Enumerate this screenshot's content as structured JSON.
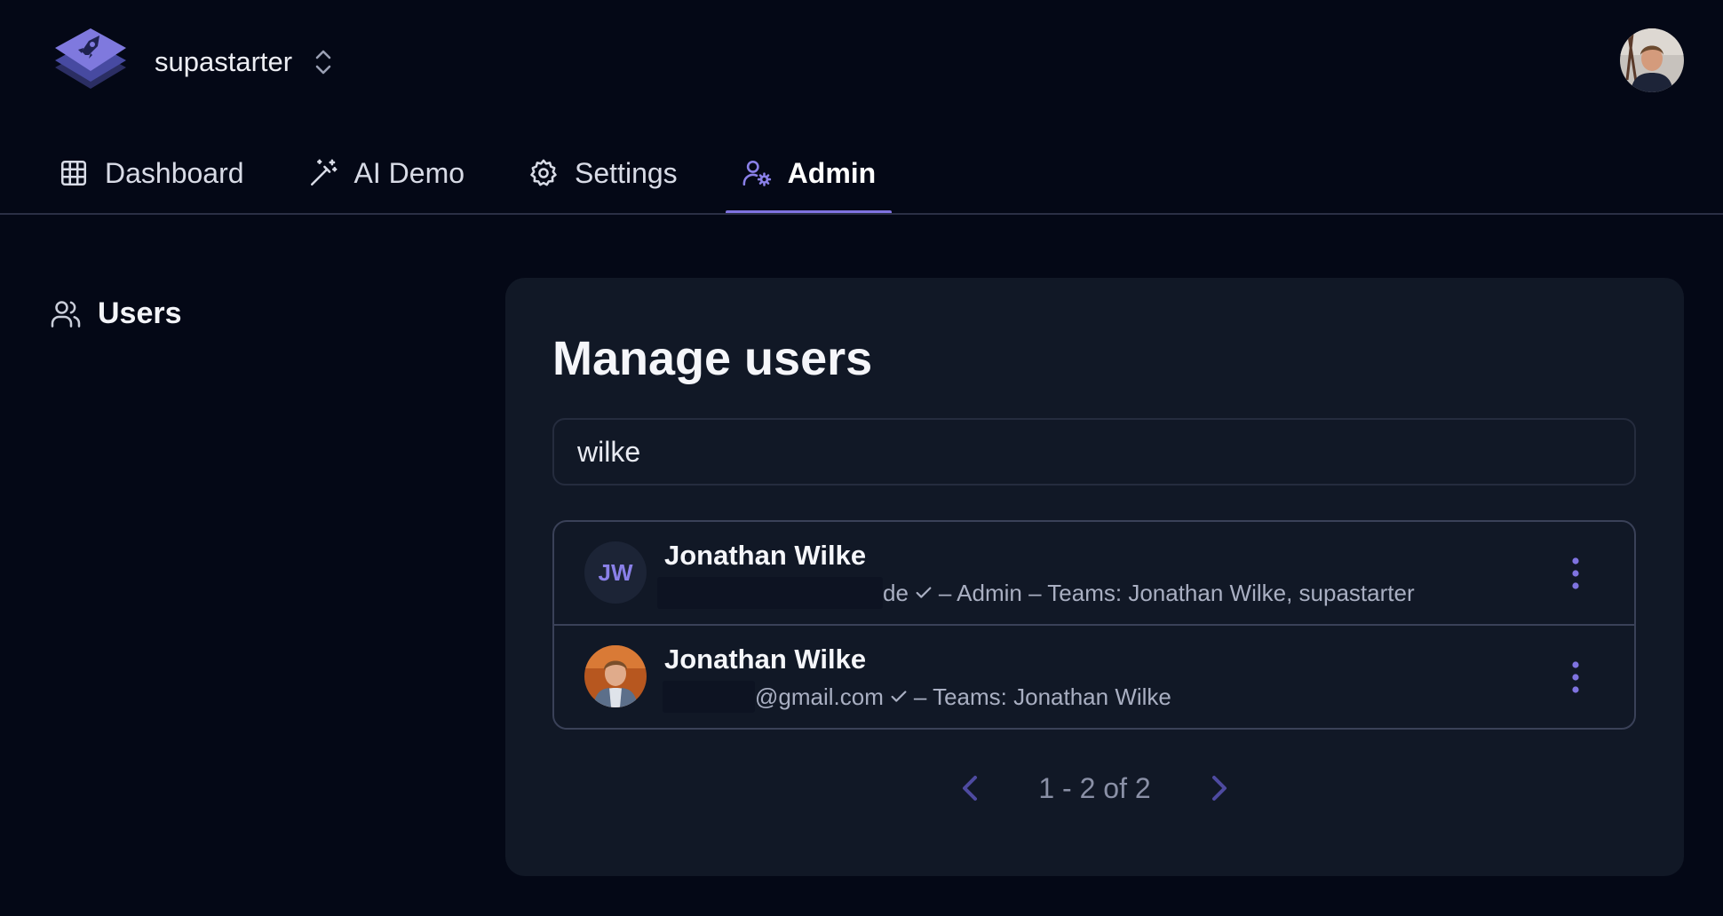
{
  "app": {
    "team_name": "supastarter"
  },
  "nav": {
    "tabs": [
      {
        "label": "Dashboard",
        "icon": "grid-icon"
      },
      {
        "label": "AI Demo",
        "icon": "magic-wand-icon"
      },
      {
        "label": "Settings",
        "icon": "gear-icon"
      },
      {
        "label": "Admin",
        "icon": "user-cog-icon",
        "active": true
      }
    ]
  },
  "sidebar": {
    "items": [
      {
        "label": "Users",
        "icon": "users-icon"
      }
    ]
  },
  "main": {
    "title": "Manage users",
    "search_value": "wilke",
    "users": [
      {
        "name": "Jonathan Wilke",
        "initials": "JW",
        "email_visible": "de",
        "meta": " – Admin – Teams: Jonathan Wilke, supastarter"
      },
      {
        "name": "Jonathan Wilke",
        "email_visible": "@gmail.com",
        "meta": " – Teams: Jonathan Wilke"
      }
    ],
    "pagination": "1 - 2 of 2"
  },
  "colors": {
    "background": "#040816",
    "card": "#111826",
    "accent": "#7f73e0"
  }
}
